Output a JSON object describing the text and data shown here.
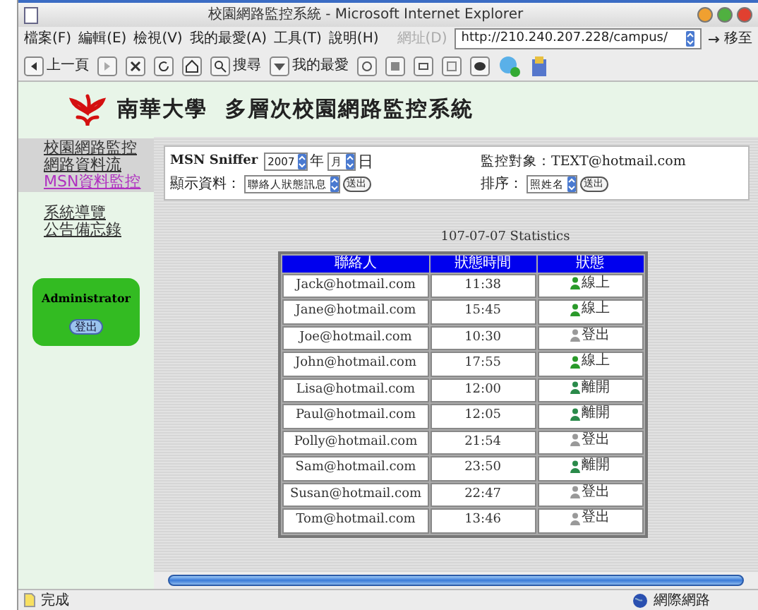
{
  "window": {
    "title": "校園網路監控系統 - Microsoft Internet Explorer"
  },
  "menu": [
    "檔案(F)",
    "編輯(E)",
    "檢視(V)",
    "我的最愛(A)",
    "工具(T)",
    "說明(H)"
  ],
  "address": {
    "label": "網址(D)",
    "value": "http://210.240.207.228/campus/",
    "go": "移至"
  },
  "toolbar": {
    "back": "上一頁",
    "search": "搜尋",
    "favorites": "我的最愛"
  },
  "site_title": "南華大學  多層次校園網路監控系統",
  "nav": [
    {
      "label": "校園網路監控",
      "selected": false
    },
    {
      "label": "網路資料流",
      "selected": false
    },
    {
      "label": "MSN資料監控",
      "selected": true
    }
  ],
  "nav_extra": [
    "系統導覽",
    "公告備忘錄"
  ],
  "user": {
    "name": "Administrator",
    "logout": "登出"
  },
  "filter": {
    "title": "MSN Sniffer",
    "year": "2007",
    "year_unit": "年",
    "month": "月",
    "day_unit": "日",
    "target_label": "監控對象：TEXT@hotmail.com",
    "show_label": "顯示資料：",
    "show_value": "聯絡人狀態訊息",
    "show_button": "送出",
    "sort_label": "排序：",
    "sort_value": "照姓名",
    "sort_button": "送出"
  },
  "table": {
    "caption": "107-07-07 Statistics",
    "columns": [
      "聯絡人",
      "狀態時間",
      "狀態"
    ],
    "rows": [
      {
        "contact": "Jack@hotmail.com",
        "time": "11:38",
        "status": "線上",
        "kind": "online"
      },
      {
        "contact": "Jane@hotmail.com",
        "time": "15:45",
        "status": "線上",
        "kind": "online"
      },
      {
        "contact": "Joe@hotmail.com",
        "time": "10:30",
        "status": "登出",
        "kind": "offline"
      },
      {
        "contact": "John@hotmail.com",
        "time": "17:55",
        "status": "線上",
        "kind": "online"
      },
      {
        "contact": "Lisa@hotmail.com",
        "time": "12:00",
        "status": "離開",
        "kind": "away"
      },
      {
        "contact": "Paul@hotmail.com",
        "time": "12:05",
        "status": "離開",
        "kind": "away"
      },
      {
        "contact": "Polly@hotmail.com",
        "time": "21:54",
        "status": "登出",
        "kind": "offline"
      },
      {
        "contact": "Sam@hotmail.com",
        "time": "23:50",
        "status": "離開",
        "kind": "away"
      },
      {
        "contact": "Susan@hotmail.com",
        "time": "22:47",
        "status": "登出",
        "kind": "offline"
      },
      {
        "contact": "Tom@hotmail.com",
        "time": "13:46",
        "status": "登出",
        "kind": "offline"
      }
    ]
  },
  "status_bar": {
    "left": "完成",
    "zone": "網際網路"
  }
}
